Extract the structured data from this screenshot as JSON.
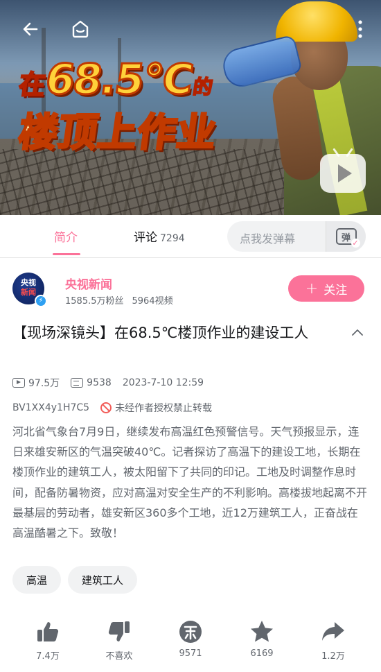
{
  "video": {
    "headline_prefix": "在",
    "headline_temp": "68.5℃",
    "headline_suffix": "的",
    "headline_line2": "楼顶上作业"
  },
  "tabs": {
    "intro_label": "简介",
    "comments_label": "评论",
    "comments_count": "7294",
    "danmaku_placeholder": "点我发弹幕",
    "danmaku_icon_text": "弹"
  },
  "author": {
    "avatar_line1": "央视",
    "avatar_line2": "新闻",
    "name": "央视新闻",
    "fans": "1585.5万粉丝",
    "videos": "5964视频",
    "follow_label": "关注"
  },
  "video_info": {
    "title": "【现场深镜头】在68.5℃楼顶作业的建设工人",
    "views": "97.5万",
    "danmaku_count": "9538",
    "date": "2023-7-10 12:59",
    "bvid": "BV1XX4y1H7C5",
    "copyright_notice": "未经作者授权禁止转载",
    "description": "河北省气象台7月9日，继续发布高温红色预警信号。天气预报显示，连日来雄安新区的气温突破40℃。记者探访了高温下的建设工地，长期在楼顶作业的建筑工人，被太阳留下了共同的印记。工地及时调整作息时间，配备防暑物资，应对高温对安全生产的不利影响。高楼拔地起离不开最基层的劳动者，雄安新区360多个工地，近12万建筑工人，正奋战在高温酷暑之下。致敬！"
  },
  "tags": [
    "高温",
    "建筑工人"
  ],
  "actions": {
    "like": "7.4万",
    "dislike": "不喜欢",
    "coin": "9571",
    "favorite": "6169",
    "share": "1.2万"
  },
  "colors": {
    "accent": "#fb7299",
    "text_primary": "#18191c",
    "text_secondary": "#61666d"
  }
}
